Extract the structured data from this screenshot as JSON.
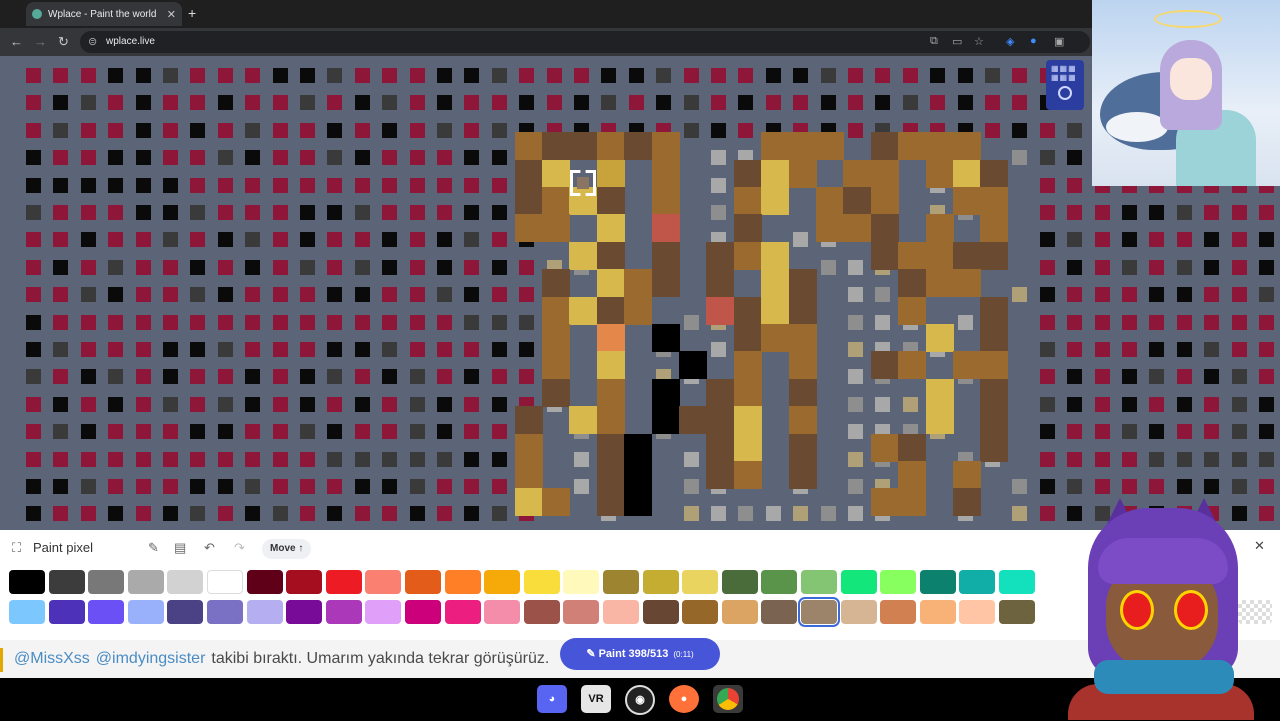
{
  "browser": {
    "tab_title": "Wplace - Paint the world",
    "url": "wplace.live"
  },
  "paint_panel": {
    "title": "Paint pixel",
    "move_label": "Move ↑",
    "palette": [
      "#000000",
      "#3c3c3c",
      "#787878",
      "#aaaaaa",
      "#d2d2d2",
      "#ffffff",
      "#600018",
      "#a50e1e",
      "#ed1c24",
      "#fa8072",
      "#e45c1a",
      "#ff7f27",
      "#f6aa09",
      "#f9dd3b",
      "#fffabc",
      "#9c8431",
      "#c5ad31",
      "#e8d45f",
      "#4a6b3a",
      "#5a944a",
      "#84c573",
      "#13e67b",
      "#87ff5e",
      "#0c816e",
      "#10aea6",
      "#13e1be",
      "#7dc7ff",
      "#4d31b8",
      "#6b50f6",
      "#99b1fb",
      "#4a4284",
      "#7a71c4",
      "#b5aef1",
      "#780c99",
      "#aa38b9",
      "#e09ff9",
      "#cb007a",
      "#ec1f80",
      "#f38da9",
      "#9b5249",
      "#d18078",
      "#fab6a4",
      "#684634",
      "#95682a",
      "#dba463",
      "#7b6352",
      "#9c846b",
      "#d6b594",
      "#d18051",
      "#f8b277",
      "#ffc5a5",
      "#6d643f"
    ],
    "selected_index": 46
  },
  "chat": {
    "user": "@MissXss",
    "mention": "@imdyingsister",
    "text": "takibi bıraktı. Umarım yakında tekrar görüşürüz."
  },
  "paint_button": {
    "label": "Paint 398/513",
    "timer": "(0:11)"
  },
  "taskbar": {
    "apps": [
      "discord-icon",
      "vrcx-icon",
      "obs-icon",
      "firefox-icon",
      "chrome-icon"
    ]
  }
}
